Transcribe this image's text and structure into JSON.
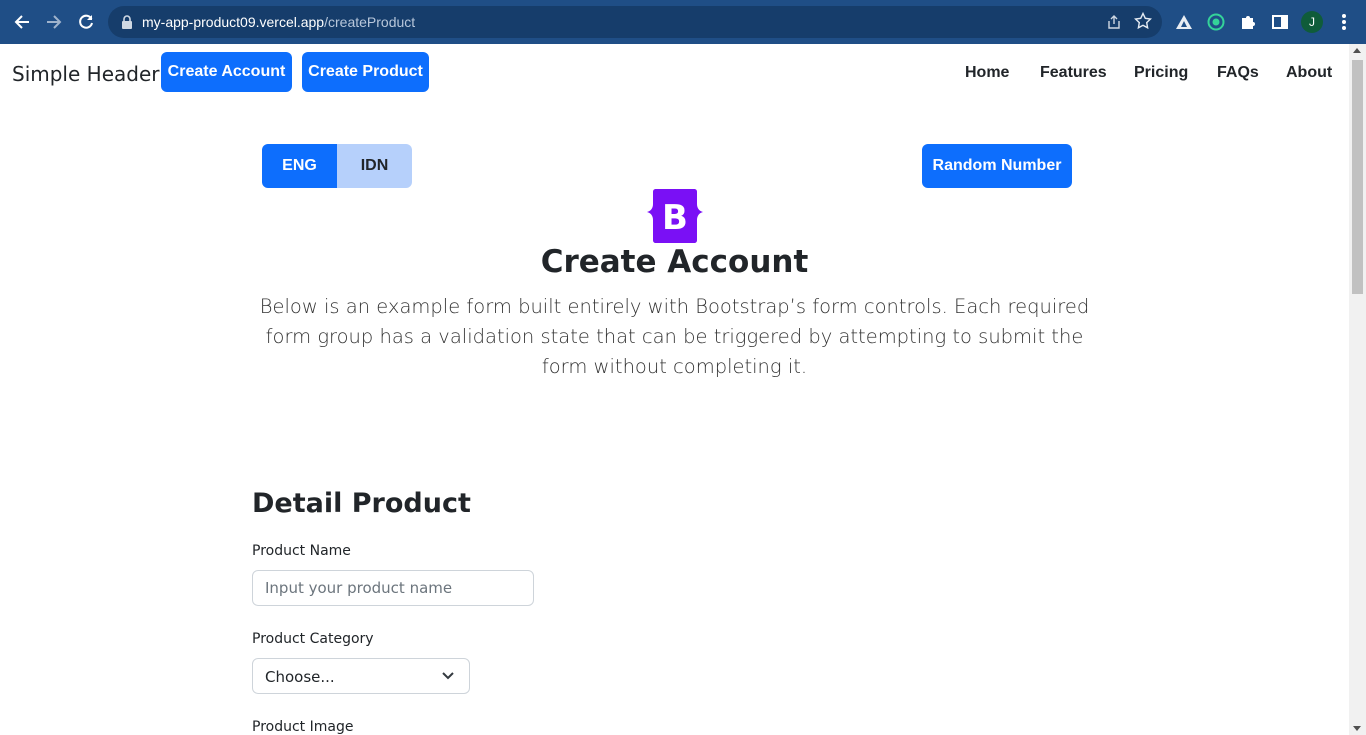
{
  "browser": {
    "url_host": "my-app-product09.vercel.app",
    "url_path": "/createProduct",
    "profile_initial": "J",
    "icons": [
      "back-icon",
      "forward-icon",
      "reload-icon",
      "lock-icon",
      "share-icon",
      "star-icon",
      "extension-drive-icon",
      "extension-circle-icon",
      "puzzle-icon",
      "sidepanel-icon",
      "menu-icon"
    ]
  },
  "header": {
    "brand": "Simple Header",
    "create_account": "Create Account",
    "create_product": "Create Product",
    "nav": [
      "Home",
      "Features",
      "Pricing",
      "FAQs",
      "About"
    ]
  },
  "lang": {
    "eng": "ENG",
    "idn": "IDN"
  },
  "random_button": "Random Number",
  "hero": {
    "logo_letter": "B",
    "title": "Create Account",
    "lead": "Below is an example form built entirely with Bootstrap’s form controls. Each required form group has a validation state that can be triggered by attempting to submit the form without completing it."
  },
  "form": {
    "section_title": "Detail Product",
    "product_name_label": "Product Name",
    "product_name_placeholder": "Input your product name",
    "product_category_label": "Product Category",
    "product_category_value": "Choose...",
    "product_image_label": "Product Image"
  },
  "colors": {
    "primary": "#0d6efd",
    "chrome": "#1f4e86",
    "logo": "#7a10f5"
  }
}
